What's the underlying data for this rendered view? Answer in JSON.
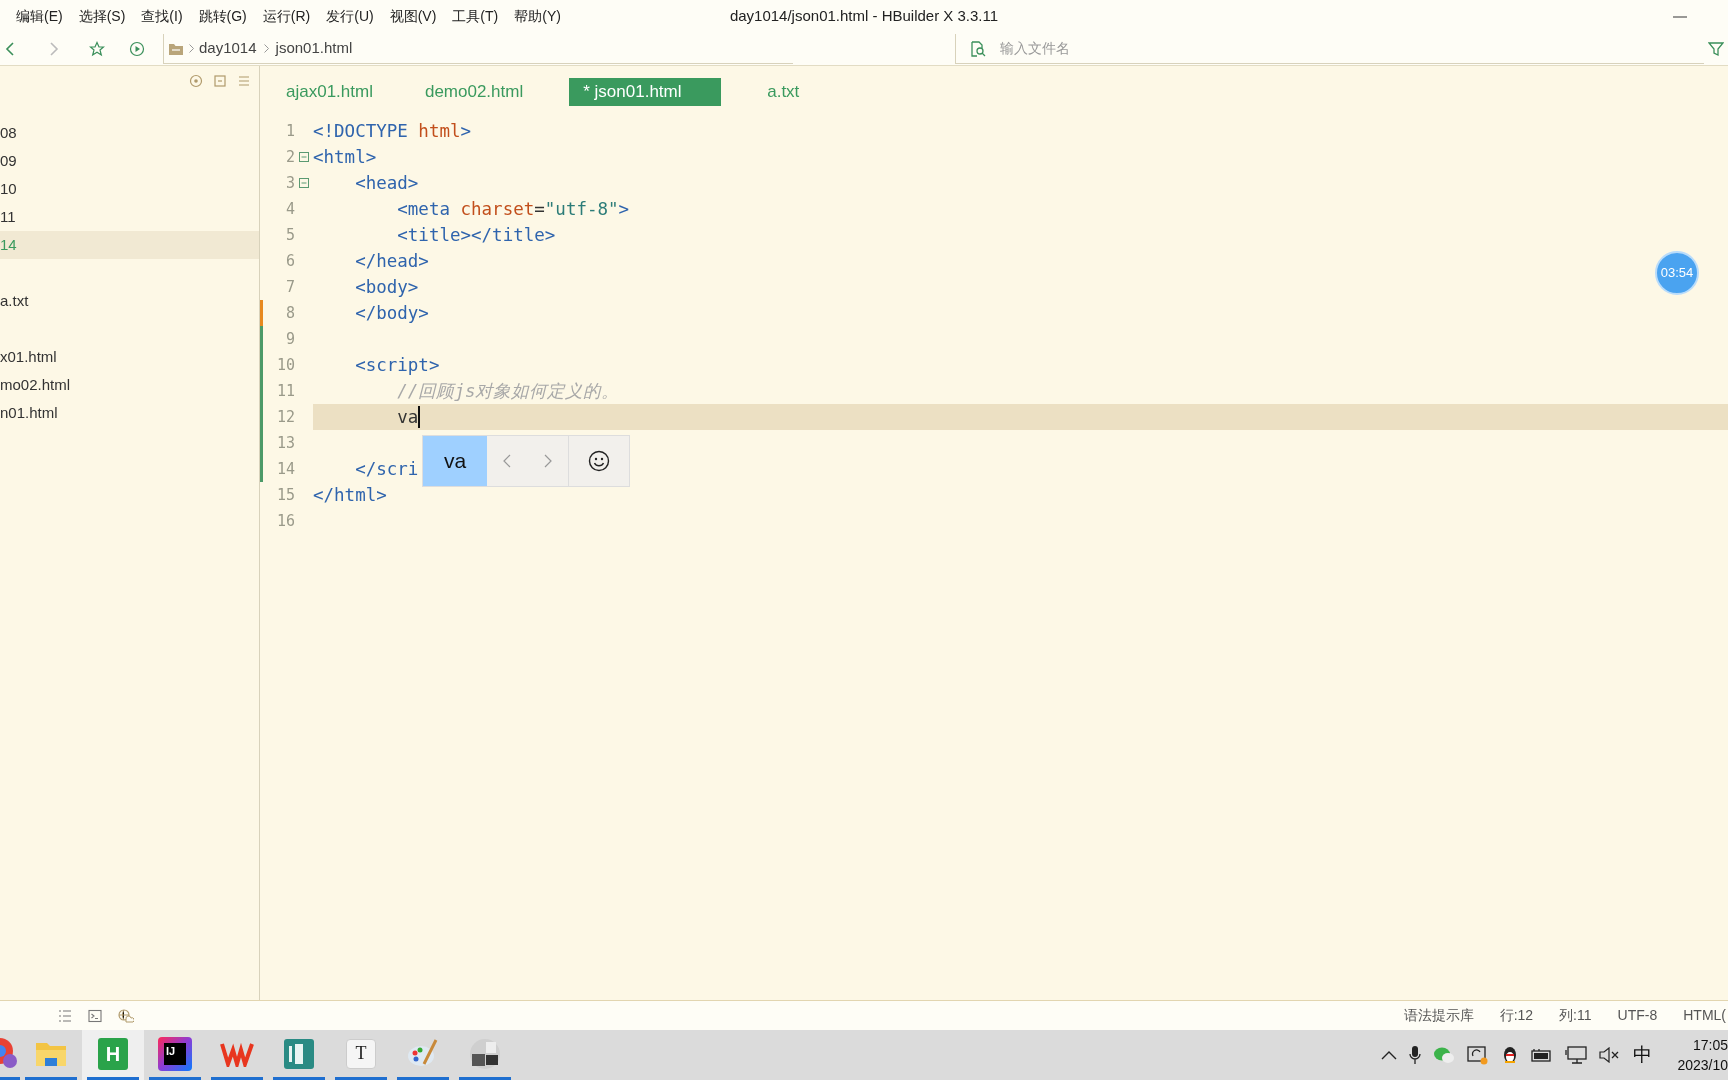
{
  "menu": [
    "编辑(E)",
    "选择(S)",
    "查找(I)",
    "跳转(G)",
    "运行(R)",
    "发行(U)",
    "视图(V)",
    "工具(T)",
    "帮助(Y)"
  ],
  "window": {
    "title": "day1014/json01.html - HBuilder X 3.3.11"
  },
  "breadcrumb": [
    "day1014",
    "json01.html"
  ],
  "file_search": {
    "placeholder": "输入文件名"
  },
  "sidebar": {
    "groups": [
      {
        "items": [
          {
            "label": "08",
            "selected": false
          },
          {
            "label": "09",
            "selected": false
          },
          {
            "label": "10",
            "selected": false
          },
          {
            "label": "11",
            "selected": false
          },
          {
            "label": "14",
            "selected": true
          }
        ]
      },
      {
        "items": [
          {
            "label": "a.txt",
            "selected": false
          }
        ]
      },
      {
        "items": [
          {
            "label": "x01.html",
            "selected": false
          },
          {
            "label": "mo02.html",
            "selected": false
          },
          {
            "label": "n01.html",
            "selected": false
          }
        ]
      }
    ]
  },
  "tabs": [
    {
      "label": "ajax01.html",
      "selected": false
    },
    {
      "label": "demo02.html",
      "selected": false
    },
    {
      "label": "* json01.html",
      "selected": true
    },
    {
      "label": "a.txt",
      "selected": false
    }
  ],
  "code": {
    "lines": [
      {
        "number": "1",
        "foldable": false,
        "modified": false,
        "added": false,
        "current": false,
        "caret": false,
        "tokens": [
          {
            "kind": "tag",
            "text": "<!DOCTYPE "
          },
          {
            "kind": "keyword",
            "text": "html"
          },
          {
            "kind": "tag",
            "text": ">"
          }
        ]
      },
      {
        "number": "2",
        "foldable": true,
        "modified": false,
        "added": false,
        "current": false,
        "caret": false,
        "tokens": [
          {
            "kind": "tag",
            "text": "<html>"
          }
        ],
        "children": [
          {
            "number": "3",
            "foldable": true,
            "modified": false,
            "added": false,
            "current": false,
            "caret": false,
            "tokens": [
              {
                "kind": "tag",
                "text": "<head>"
              }
            ],
            "children": [
              {
                "number": "4",
                "foldable": false,
                "modified": false,
                "added": false,
                "current": false,
                "caret": false,
                "tokens": [
                  {
                    "kind": "tag",
                    "text": "<meta "
                  },
                  {
                    "kind": "keyword",
                    "text": "charset"
                  },
                  {
                    "kind": "text",
                    "text": "="
                  },
                  {
                    "kind": "string",
                    "text": "\"utf-8\""
                  },
                  {
                    "kind": "tag",
                    "text": ">"
                  }
                ]
              },
              {
                "number": "5",
                "foldable": false,
                "modified": false,
                "added": false,
                "current": false,
                "caret": false,
                "tokens": [
                  {
                    "kind": "tag",
                    "text": "<title></title>"
                  }
                ]
              }
            ]
          },
          {
            "number": "6",
            "foldable": false,
            "modified": false,
            "added": false,
            "current": false,
            "caret": false,
            "tokens": [
              {
                "kind": "tag",
                "text": "</head>"
              }
            ]
          },
          {
            "number": "7",
            "foldable": false,
            "modified": false,
            "added": false,
            "current": false,
            "caret": false,
            "tokens": [
              {
                "kind": "tag",
                "text": "<body>"
              }
            ]
          },
          {
            "number": "8",
            "foldable": false,
            "modified": true,
            "added": false,
            "current": false,
            "caret": false,
            "tokens": [
              {
                "kind": "tag",
                "text": "</body>"
              }
            ]
          },
          {
            "number": "9",
            "foldable": false,
            "modified": false,
            "added": true,
            "current": false,
            "caret": false
          },
          {
            "number": "10",
            "foldable": false,
            "modified": false,
            "added": true,
            "current": false,
            "caret": false,
            "tokens": [
              {
                "kind": "tag",
                "text": "<script>"
              }
            ],
            "children": [
              {
                "number": "11",
                "foldable": false,
                "modified": false,
                "added": true,
                "current": false,
                "caret": false,
                "tokens": [
                  {
                    "kind": "comment",
                    "text": "//回顾js对象如何定义的。"
                  }
                ]
              },
              {
                "number": "12",
                "foldable": false,
                "modified": false,
                "added": true,
                "current": true,
                "caret": true,
                "tokens": [
                  {
                    "kind": "text",
                    "text": "va"
                  }
                ]
              },
              {
                "number": "13",
                "foldable": false,
                "modified": false,
                "added": true,
                "current": false,
                "caret": false
              }
            ]
          },
          {
            "number": "14",
            "foldable": false,
            "modified": false,
            "added": true,
            "current": false,
            "caret": false,
            "tokens": [
              {
                "kind": "tag",
                "text": "</scri"
              }
            ]
          }
        ]
      },
      {
        "number": "15",
        "foldable": false,
        "modified": false,
        "added": false,
        "current": false,
        "caret": false,
        "tokens": [
          {
            "kind": "tag",
            "text": "</html>"
          }
        ]
      },
      {
        "number": "16",
        "foldable": false,
        "modified": false,
        "added": false,
        "current": false,
        "caret": false
      }
    ]
  },
  "ime_popup": {
    "candidate": "va",
    "selected": true
  },
  "timer": "03:54",
  "status_bar": [
    "语法提示库",
    "行:12",
    "列:11",
    "UTF-8",
    "HTML("
  ],
  "taskbar": {
    "apps": [
      {
        "kind": "chrome",
        "active": false
      },
      {
        "kind": "folder",
        "active": false
      },
      {
        "kind": "hbuilder",
        "glyph": "H",
        "active": true
      },
      {
        "kind": "ij",
        "glyph": "IJ",
        "active": false
      },
      {
        "kind": "wps",
        "active": false
      },
      {
        "kind": "reader",
        "active": false
      },
      {
        "kind": "typora",
        "glyph": "T",
        "active": false
      },
      {
        "kind": "paint",
        "active": false
      },
      {
        "kind": "photo",
        "active": false
      }
    ],
    "ime": "中",
    "time": "17:05",
    "date": "2023/10"
  }
}
